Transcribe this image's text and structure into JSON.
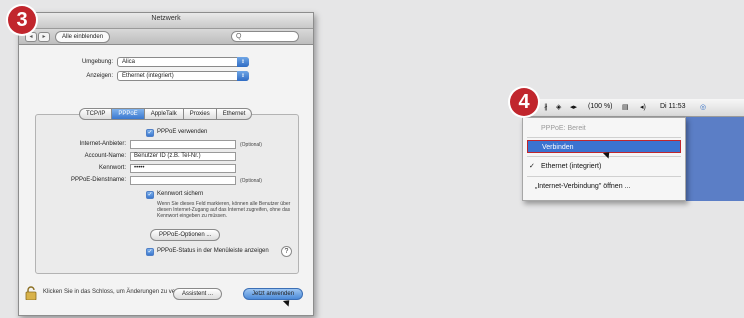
{
  "steps": {
    "left": "3",
    "right": "4"
  },
  "window": {
    "title": "Netzwerk",
    "toolbar": {
      "back": "◂",
      "forward": "▸",
      "show_all": "Alle einblenden",
      "search": "Q"
    }
  },
  "form": {
    "location_label": "Umgebung:",
    "location_value": "Alica",
    "show_label": "Anzeigen:",
    "show_value": "Ethernet (integriert)"
  },
  "tabs": [
    "TCP/IP",
    "PPPoE",
    "AppleTalk",
    "Proxies",
    "Ethernet"
  ],
  "pppoe": {
    "use_label": "PPPoE verwenden",
    "provider_label": "Internet-Anbieter:",
    "provider_optional": "(Optional)",
    "account_label": "Account-Name:",
    "account_value": "Benutzer ID (z.B. Tel-Nr.)",
    "password_label": "Kennwort:",
    "password_value": "•••••",
    "service_label": "PPPoE-Dienstname:",
    "service_optional": "(Optional)",
    "save_password_label": "Kennwort sichern",
    "save_password_note": "Wenn Sie dieses Feld markieren, können alle Benutzer über diesen Internet-Zugang auf das Internet zugreifen, ohne das Kennwort eingeben zu müssen.",
    "options_button": "PPPoE-Optionen ...",
    "show_status_label": "PPPoE-Status in der Menüleiste anzeigen",
    "help": "?"
  },
  "footer": {
    "lock_text": "Klicken Sie in das Schloss, um Änderungen zu verhindern.",
    "assistant_button": "Assistent ...",
    "apply_button": "Jetzt anwenden"
  },
  "menubar": {
    "items": [
      "∦",
      "◈",
      "◂▸",
      "(100 %)",
      "▤",
      "◂)",
      "Di 11:53",
      "◎"
    ]
  },
  "menu": {
    "status": "PPPoE: Bereit",
    "connect": "Verbinden",
    "ethernet": "Ethernet (integriert)",
    "open": "„Internet-Verbindung\" öffnen ..."
  }
}
